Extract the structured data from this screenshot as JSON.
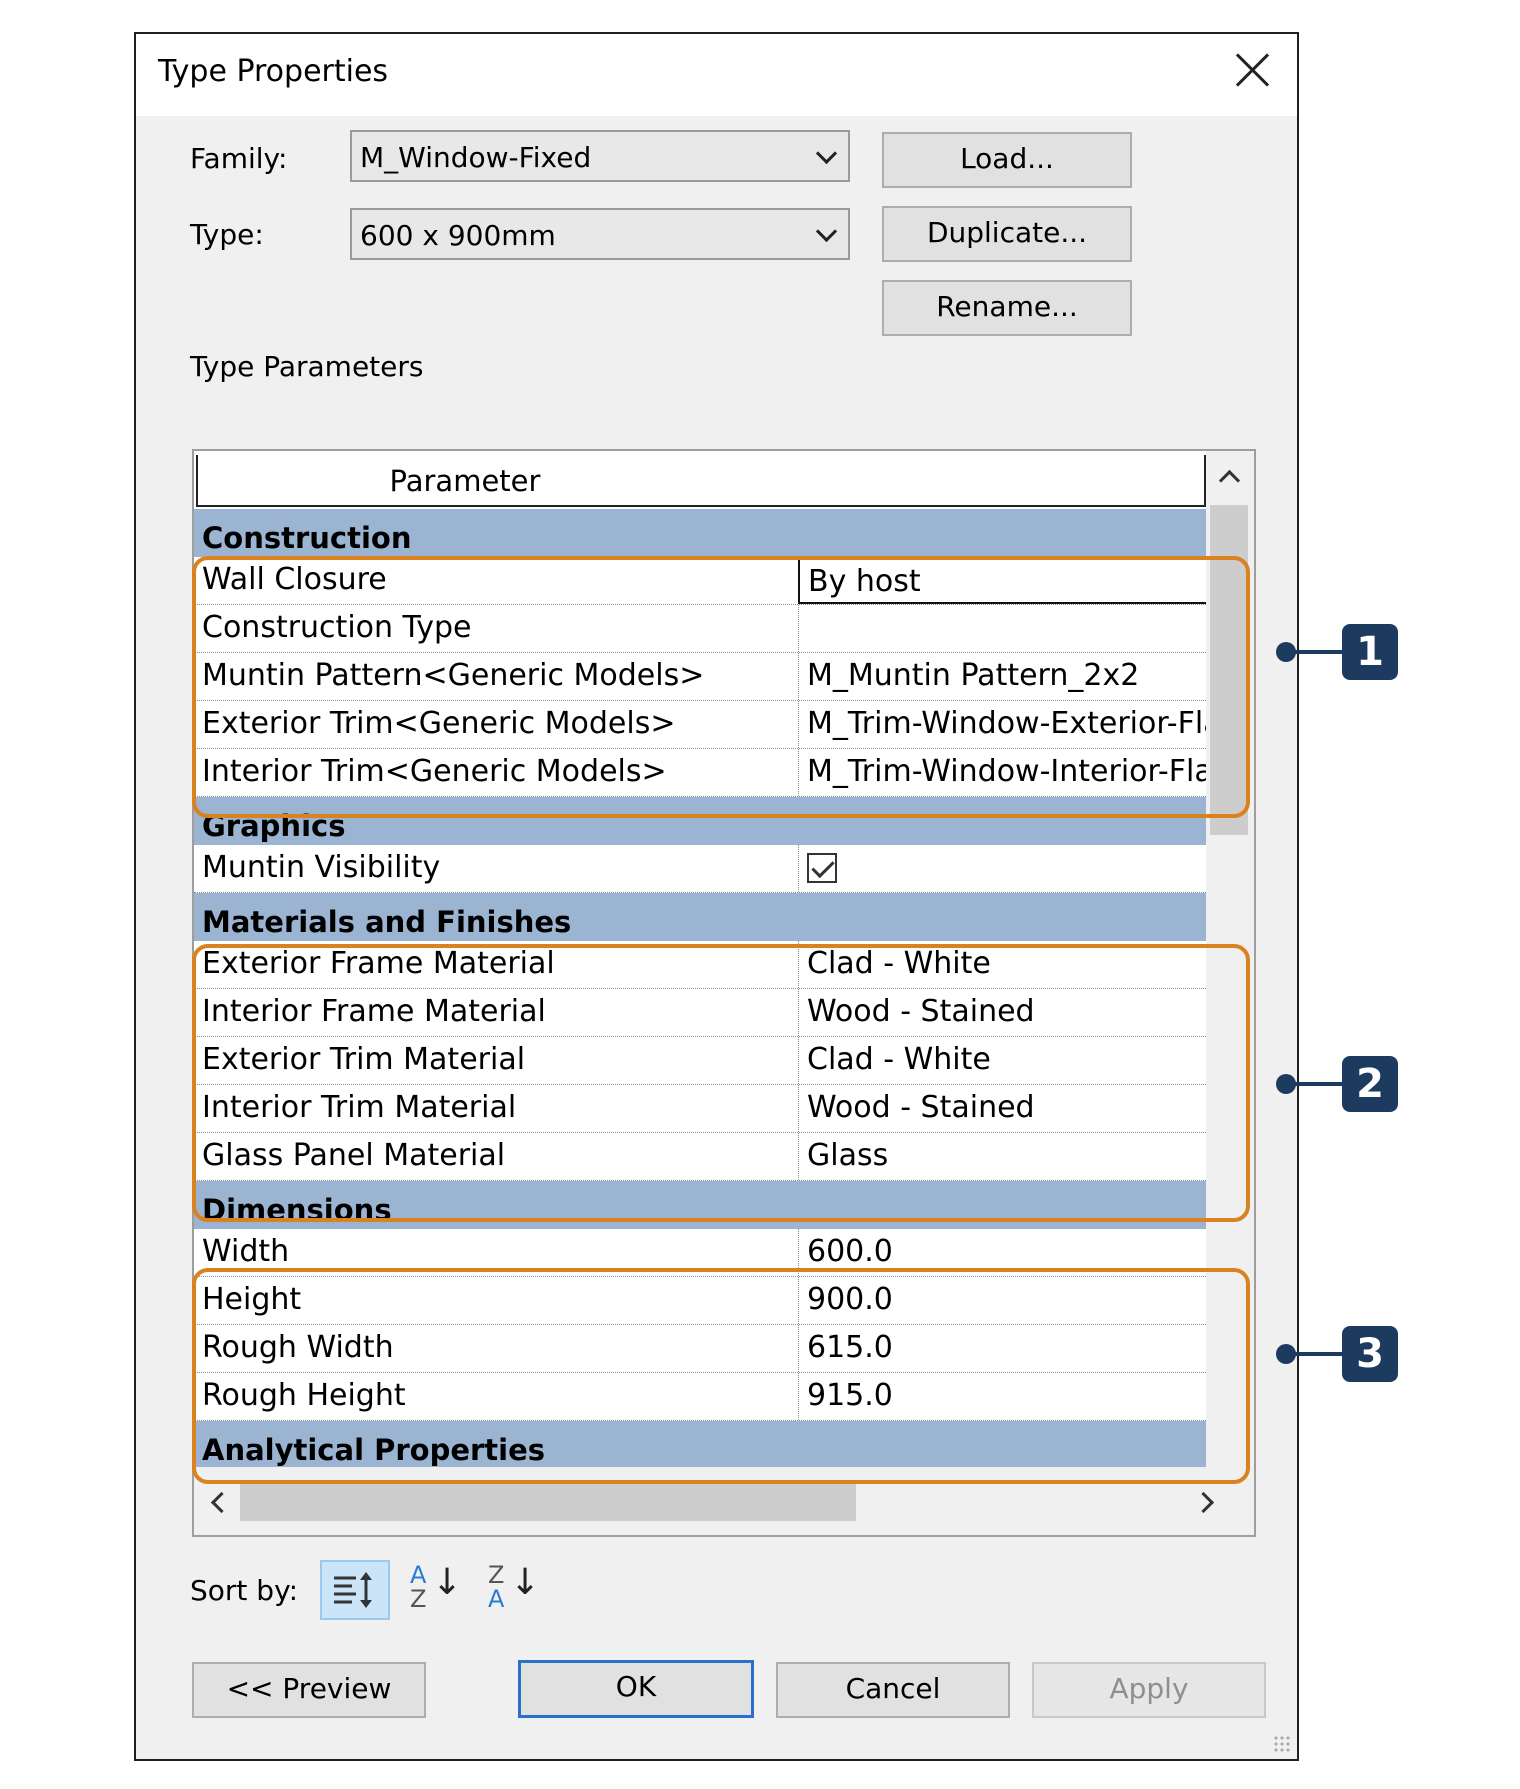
{
  "dialog": {
    "title": "Type Properties"
  },
  "family": {
    "label": "Family:",
    "value": "M_Window-Fixed"
  },
  "type": {
    "label": "Type:",
    "value": "600 x 900mm"
  },
  "buttons": {
    "load": "Load...",
    "duplicate": "Duplicate...",
    "rename": "Rename..."
  },
  "type_parameters": {
    "heading": "Type Parameters",
    "col_parameter": "Parameter",
    "col_value": "",
    "groups": [
      {
        "name": "Construction",
        "rows": [
          {
            "param": "Wall Closure",
            "value": "By host"
          },
          {
            "param": "Construction Type",
            "value": ""
          },
          {
            "param": "Muntin Pattern<Generic Models>",
            "value": "M_Muntin Pattern_2x2"
          },
          {
            "param": "Exterior Trim<Generic Models>",
            "value": "M_Trim-Window-Exterior-Fla"
          },
          {
            "param": "Interior Trim<Generic Models>",
            "value": "M_Trim-Window-Interior-Fla"
          }
        ]
      },
      {
        "name": "Graphics",
        "rows": [
          {
            "param": "Muntin Visibility",
            "checked": true
          }
        ]
      },
      {
        "name": "Materials and Finishes",
        "rows": [
          {
            "param": "Exterior Frame Material",
            "value": "Clad - White"
          },
          {
            "param": "Interior Frame Material",
            "value": "Wood - Stained"
          },
          {
            "param": "Exterior Trim Material",
            "value": "Clad - White"
          },
          {
            "param": "Interior Trim Material",
            "value": "Wood - Stained"
          },
          {
            "param": "Glass Panel Material",
            "value": "Glass"
          }
        ]
      },
      {
        "name": "Dimensions",
        "rows": [
          {
            "param": "Width",
            "value": "600.0"
          },
          {
            "param": "Height",
            "value": "900.0"
          },
          {
            "param": "Rough Width",
            "value": "615.0"
          },
          {
            "param": "Rough Height",
            "value": "915.0"
          }
        ]
      },
      {
        "name": "Analytical Properties",
        "rows": []
      }
    ]
  },
  "sort": {
    "label": "Sort by:",
    "a_letter": "A",
    "z_letter": "Z",
    "arrow": "↓"
  },
  "footer": {
    "preview": "<< Preview",
    "ok": "OK",
    "cancel": "Cancel",
    "apply": "Apply"
  },
  "callouts": [
    "1",
    "2",
    "3"
  ],
  "colors": {
    "category_band": "#9ab4d2",
    "highlight": "#d9821f",
    "callout": "#1d3a5f",
    "default_border": "#2a6fc9"
  }
}
